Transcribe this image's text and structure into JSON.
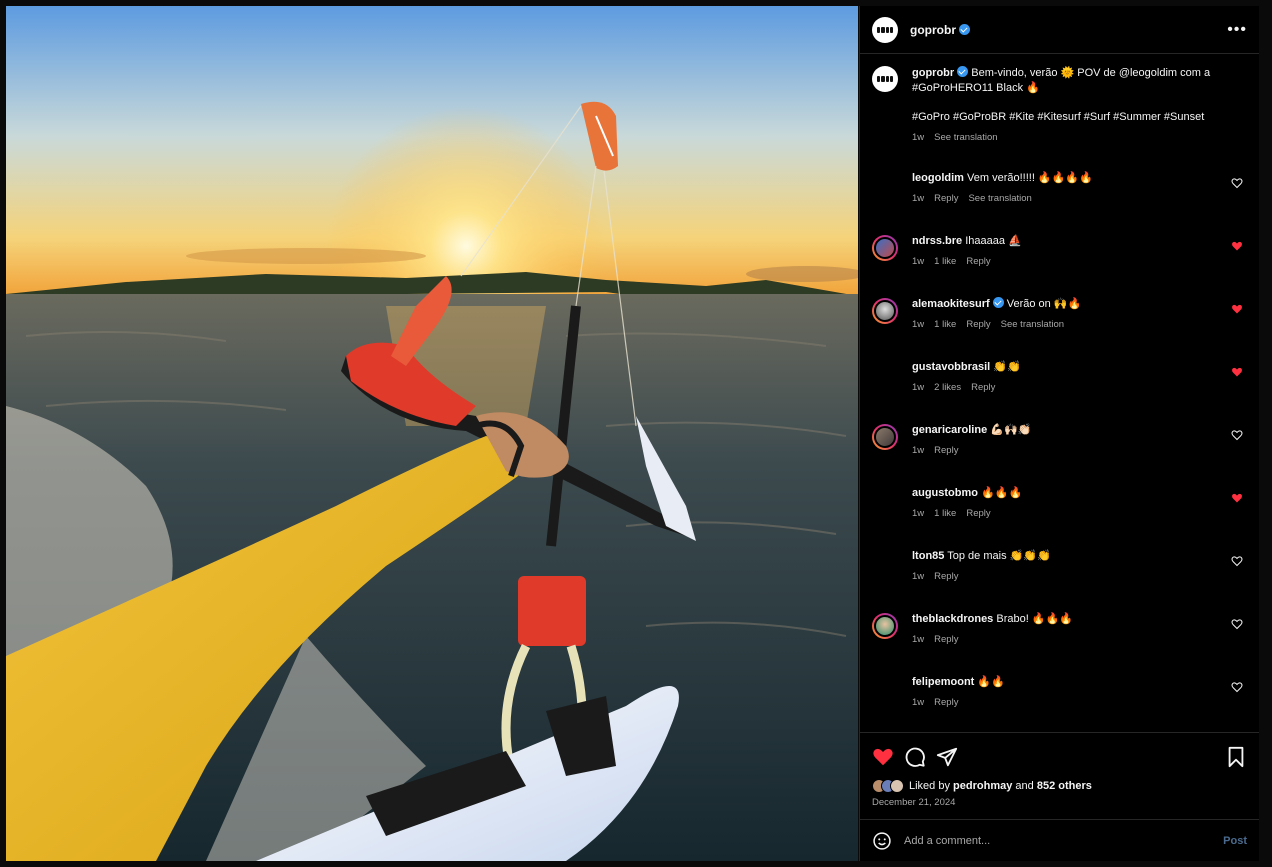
{
  "post": {
    "username": "goprobr",
    "verified": true,
    "more_icon": "more-horizontal-icon"
  },
  "caption": {
    "username": "goprobr",
    "text": "Bem-vindo, verão 🌞 POV de @leogoldim com a #GoProHERO11 Black 🔥",
    "hashtags": "#GoPro #GoProBR #Kite #Kitesurf #Surf #Summer #Sunset",
    "time": "1w",
    "translate": "See translation"
  },
  "comments": [
    {
      "username": "leogoldim",
      "text": "Vem verão!!!!! 🔥🔥🔥🔥",
      "time": "1w",
      "likes": "",
      "reply": "Reply",
      "translate": "See translation",
      "liked": false
    },
    {
      "username": "ndrss.bre",
      "text": "Ihaaaaa ⛵",
      "time": "1w",
      "likes": "1 like",
      "reply": "Reply",
      "translate": "",
      "liked": true
    },
    {
      "username": "alemaokitesurf",
      "verified": true,
      "text": "Verão on 🙌🔥",
      "time": "1w",
      "likes": "1 like",
      "reply": "Reply",
      "translate": "See translation",
      "liked": true
    },
    {
      "username": "gustavobbrasil",
      "text": "👏👏",
      "time": "1w",
      "likes": "2 likes",
      "reply": "Reply",
      "translate": "",
      "liked": true
    },
    {
      "username": "genaricaroline",
      "text": "💪🏻🙌🏻👏🏻",
      "time": "1w",
      "likes": "",
      "reply": "Reply",
      "translate": "",
      "liked": false
    },
    {
      "username": "augustobmo",
      "text": "🔥🔥🔥",
      "time": "1w",
      "likes": "1 like",
      "reply": "Reply",
      "translate": "",
      "liked": true
    },
    {
      "username": "lton85",
      "text": "Top de mais 👏👏👏",
      "time": "1w",
      "likes": "",
      "reply": "Reply",
      "translate": "",
      "liked": false
    },
    {
      "username": "theblackdrones",
      "text": "Brabo! 🔥🔥🔥",
      "time": "1w",
      "likes": "",
      "reply": "Reply",
      "translate": "",
      "liked": false
    },
    {
      "username": "felipemoont",
      "text": "🔥🔥",
      "time": "1w",
      "likes": "",
      "reply": "Reply",
      "translate": "",
      "liked": false
    }
  ],
  "actions": {
    "like_icon": "heart-filled-icon",
    "comment_icon": "comment-bubble-icon",
    "share_icon": "send-paper-plane-icon",
    "save_icon": "bookmark-icon",
    "like_color": "#ff3040"
  },
  "likes": {
    "prefix": "Liked by",
    "user": "pedrohmay",
    "middle": "and",
    "others": "852 others"
  },
  "date": "December 21, 2024",
  "comment_box": {
    "placeholder": "Add a comment...",
    "post_label": "Post",
    "emoji_icon": "smiley-icon"
  },
  "colors": {
    "background": "#000000",
    "text": "#f5f5f5",
    "secondary_text": "#a8a8a8",
    "verified": "#3897f0",
    "liked": "#ff3040",
    "post_button": "#4a6b8f"
  }
}
